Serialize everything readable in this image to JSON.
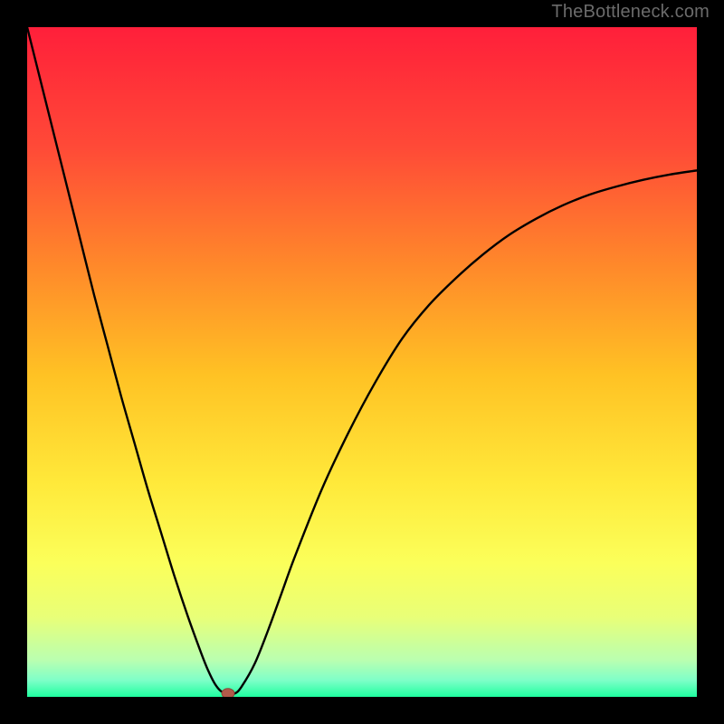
{
  "watermark": "TheBottleneck.com",
  "colors": {
    "frame": "#000000",
    "curve": "#000000",
    "marker_fill": "#b15a4a",
    "marker_stroke": "#8a4438"
  },
  "gradient_stops": [
    {
      "offset": 0.0,
      "color": "#ff1f3a"
    },
    {
      "offset": 0.18,
      "color": "#ff4a37"
    },
    {
      "offset": 0.36,
      "color": "#ff8a2a"
    },
    {
      "offset": 0.52,
      "color": "#ffc224"
    },
    {
      "offset": 0.68,
      "color": "#ffe93a"
    },
    {
      "offset": 0.8,
      "color": "#fbff5a"
    },
    {
      "offset": 0.88,
      "color": "#e9ff77"
    },
    {
      "offset": 0.945,
      "color": "#baffb0"
    },
    {
      "offset": 0.975,
      "color": "#7fffc8"
    },
    {
      "offset": 1.0,
      "color": "#1fffa0"
    }
  ],
  "chart_data": {
    "type": "line",
    "title": "",
    "xlabel": "",
    "ylabel": "",
    "xlim": [
      0,
      100
    ],
    "ylim": [
      0,
      100
    ],
    "grid": false,
    "legend": null,
    "series": [
      {
        "name": "bottleneck-curve",
        "x": [
          0,
          2,
          4,
          6,
          8,
          10,
          12,
          14,
          16,
          18,
          20,
          22,
          24,
          26,
          27,
          28,
          29,
          30,
          31,
          32,
          34,
          36,
          38,
          40,
          44,
          48,
          52,
          56,
          60,
          64,
          68,
          72,
          76,
          80,
          84,
          88,
          92,
          96,
          100
        ],
        "y": [
          100,
          92,
          84,
          76,
          68,
          60,
          52.5,
          45,
          38,
          31,
          24.5,
          18,
          12,
          6.5,
          4,
          2,
          0.8,
          0.5,
          0.5,
          1.5,
          5,
          10,
          15.5,
          21,
          31,
          39.5,
          47,
          53.5,
          58.5,
          62.5,
          66,
          69,
          71.4,
          73.4,
          75,
          76.2,
          77.2,
          78,
          78.6
        ]
      }
    ],
    "marker": {
      "x": 30,
      "y": 0.5
    }
  }
}
